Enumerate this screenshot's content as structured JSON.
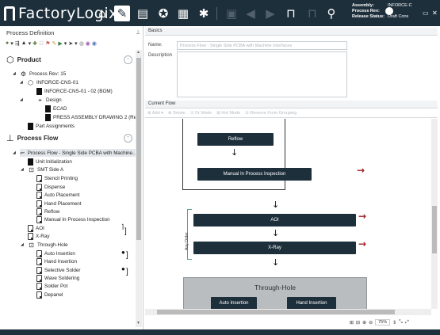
{
  "app": {
    "logo_text": "FactoryLogix",
    "assembly_label": "Assembly:",
    "assembly_value": "INFORCE-C",
    "process_rev_label": "Process Rev:",
    "release_status_label": "Release Status:",
    "release_status_value": "Draft Cons",
    "toolbar_icons": [
      "home-icon",
      "process-icon",
      "document-icon",
      "compass-icon",
      "report-icon",
      "settings-icon",
      "save-icon",
      "back-icon",
      "forward-icon",
      "lock-icon",
      "unlock-icon",
      "user-search-icon"
    ],
    "colors": {
      "topbar": "#1e2f3c",
      "step": "#1e2f3c",
      "arrow_red": "#a02027",
      "bracket_green": "#5aa77a"
    }
  },
  "left": {
    "title": "Process Definition",
    "product_header": "Product",
    "product_tree": [
      {
        "label": "Process Rev: 15"
      },
      {
        "label": "INFORCE-CNS-01"
      },
      {
        "label": "INFORCE-CNS-01 - 02 (BOM)"
      },
      {
        "label": "Design"
      },
      {
        "label": "ECAD"
      },
      {
        "label": "PRESS ASSEMBLY DRAWING 2 (Re..."
      },
      {
        "label": "Part Assignments"
      }
    ],
    "flow_header": "Process Flow",
    "flow_tree": [
      {
        "label": "Process Flow - Single Side PCBA with Machine..."
      },
      {
        "label": "Unit Initialization"
      },
      {
        "label": "SMT Side A"
      },
      {
        "label": "Stencil Printing"
      },
      {
        "label": "Dispense"
      },
      {
        "label": "Auto Placement"
      },
      {
        "label": "Hand Placement"
      },
      {
        "label": "Reflow"
      },
      {
        "label": "Manual In Process Inspection"
      },
      {
        "label": "AOI"
      },
      {
        "label": "X-Ray"
      },
      {
        "label": "Through-Hole"
      },
      {
        "label": "Auto Insertion"
      },
      {
        "label": "Hand Insertion"
      },
      {
        "label": "Selective Solder"
      },
      {
        "label": "Wave Soldering"
      },
      {
        "label": "Solder Pot"
      },
      {
        "label": "Depanel"
      }
    ]
  },
  "right": {
    "basics_title": "Basics",
    "name_label": "Name:",
    "name_value": "Process Flow - Single Side PCBA with Machine Interfaces",
    "description_label": "Description",
    "current_flow_title": "Current Flow",
    "toolbar": [
      "Add",
      "Delete",
      "Dr Mode",
      "Hot Mode",
      "Remove From Grouping"
    ],
    "steps": {
      "reflow": "Reflow",
      "manual_inspection": "Manual In Process Inspection",
      "aoi": "AOI",
      "xray": "X-Ray",
      "through_hole": "Through-Hole",
      "auto_insertion": "Auto Insertion",
      "hand_insertion": "Hand Insertion"
    },
    "any_order_label": "Any Order",
    "zoom": "75%"
  }
}
